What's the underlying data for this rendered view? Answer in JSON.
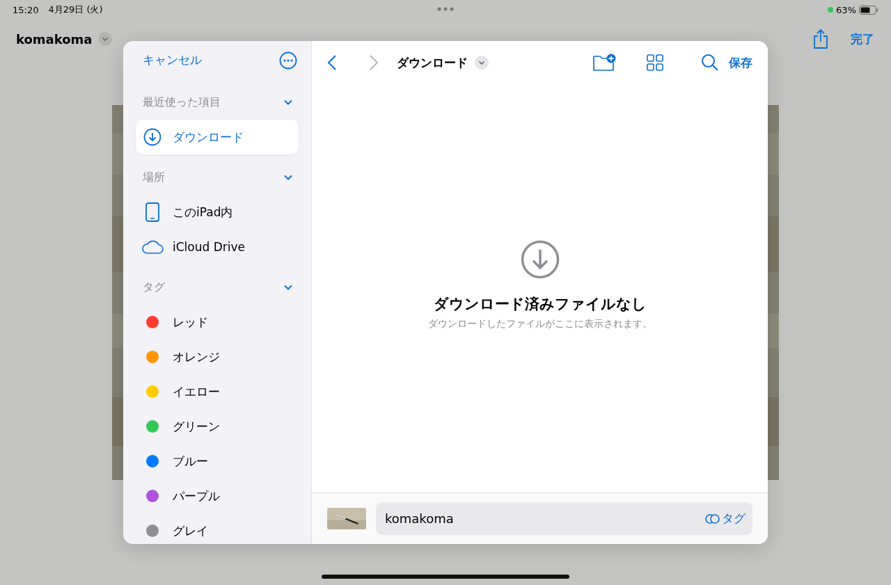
{
  "status_bar": {
    "time": "15:20",
    "date": "4月29日 (火)",
    "battery": "63%"
  },
  "app_bar": {
    "title": "komakoma",
    "done": "完了"
  },
  "dialog": {
    "cancel": "キャンセル",
    "sections": [
      {
        "title": "最近使った項目",
        "expanded": true,
        "items": [
          {
            "label": "ダウンロード",
            "kind": "download",
            "selected": true
          }
        ]
      },
      {
        "title": "場所",
        "expanded": true,
        "items": [
          {
            "label": "このiPad内",
            "kind": "ipad",
            "selected": false
          },
          {
            "label": "iCloud Drive",
            "kind": "cloud",
            "selected": false
          }
        ]
      },
      {
        "title": "タグ",
        "expanded": true,
        "items": [
          {
            "label": "レッド",
            "kind": "tag",
            "selected": false,
            "color": "#ff3b30"
          },
          {
            "label": "オレンジ",
            "kind": "tag",
            "selected": false,
            "color": "#ff9500"
          },
          {
            "label": "イエロー",
            "kind": "tag",
            "selected": false,
            "color": "#ffcc00"
          },
          {
            "label": "グリーン",
            "kind": "tag",
            "selected": false,
            "color": "#34c759"
          },
          {
            "label": "ブルー",
            "kind": "tag",
            "selected": false,
            "color": "#007aff"
          },
          {
            "label": "パープル",
            "kind": "tag",
            "selected": false,
            "color": "#af52de"
          },
          {
            "label": "グレイ",
            "kind": "tag",
            "selected": false,
            "color": "#8e8e93"
          }
        ]
      }
    ],
    "toolbar": {
      "folder": "ダウンロード",
      "save": "保存"
    },
    "empty": {
      "title": "ダウンロード済みファイルなし",
      "subtitle": "ダウンロードしたファイルがここに表示されます。"
    },
    "bottom": {
      "filename": "komakoma",
      "tag_button": "タグ"
    }
  }
}
